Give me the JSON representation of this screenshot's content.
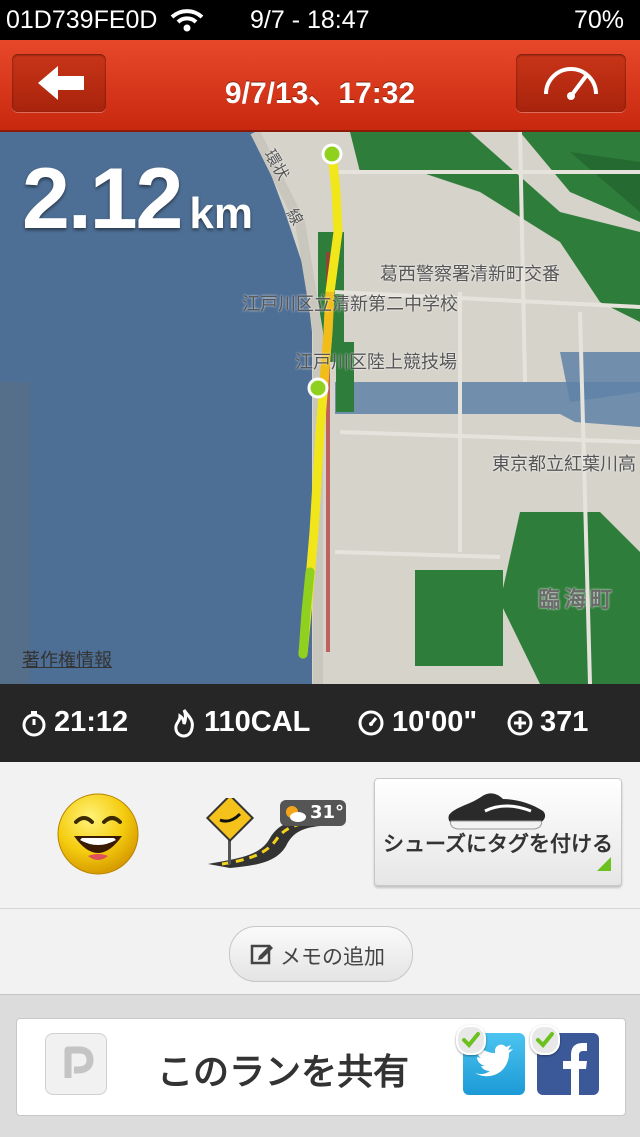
{
  "status_bar": {
    "carrier": "01D739FE0D",
    "datetime": "9/7 - 18:47",
    "battery": "70%"
  },
  "header": {
    "title": "9/7/13、17:32"
  },
  "map": {
    "distance_value": "2.12",
    "distance_unit": "km",
    "labels": {
      "police_box": "葛西警察署清新町交番",
      "school": "江戸川区立清新第二中学校",
      "stadium": "江戸川区陸上競技場",
      "high_school": "東京都立紅葉川高",
      "town": "臨海町",
      "road": "環状",
      "road2": "線",
      "copyright": "著作権情報"
    }
  },
  "stats": {
    "duration": "21:12",
    "calories": "110CAL",
    "pace": "10'00\"",
    "fuel": "371"
  },
  "details": {
    "weather_temp": "31°",
    "shoe_tag_label": "シューズにタグを付ける",
    "memo_label": "メモの追加"
  },
  "share": {
    "label": "このランを共有"
  },
  "colors": {
    "nav_red": "#d83a1c",
    "route_yellow": "#f0e61a",
    "route_green": "#8fd11e"
  }
}
